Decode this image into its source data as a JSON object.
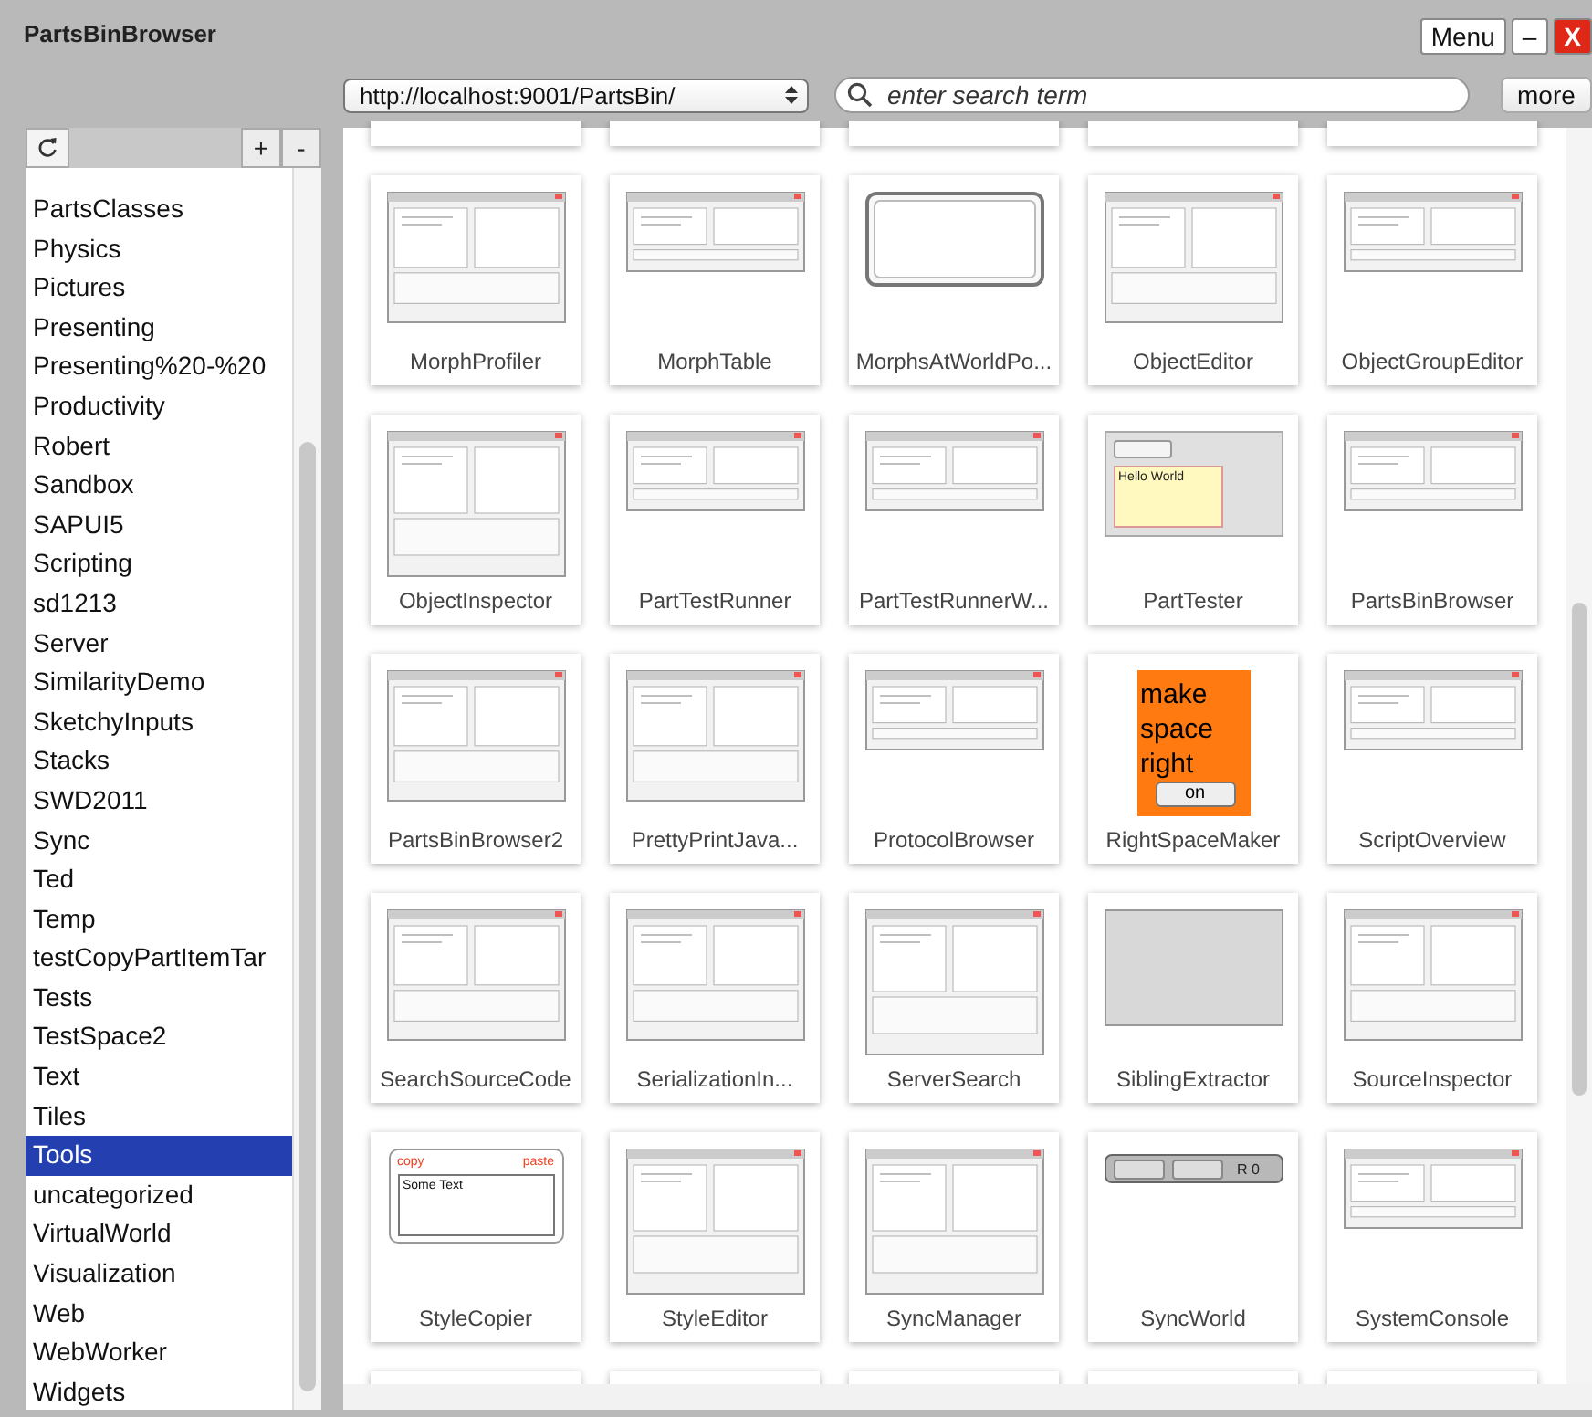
{
  "window": {
    "title": "PartsBinBrowser",
    "buttons": [
      {
        "label": "Menu",
        "kind": "text"
      },
      {
        "label": "–",
        "kind": "text"
      },
      {
        "label": "X",
        "kind": "close"
      }
    ]
  },
  "toolbar": {
    "url": "http://localhost:9001/PartsBin/",
    "search": {
      "placeholder": "enter search term"
    },
    "more_button": "more"
  },
  "categories": {
    "add_button": "+",
    "remove_button": "-",
    "items": [
      {
        "label": "PartsClasses",
        "selected": false
      },
      {
        "label": "Physics",
        "selected": false
      },
      {
        "label": "Pictures",
        "selected": false
      },
      {
        "label": "Presenting",
        "selected": false
      },
      {
        "label": "Presenting%20-%20",
        "selected": false
      },
      {
        "label": "Productivity",
        "selected": false
      },
      {
        "label": "Robert",
        "selected": false
      },
      {
        "label": "Sandbox",
        "selected": false
      },
      {
        "label": "SAPUI5",
        "selected": false
      },
      {
        "label": "Scripting",
        "selected": false
      },
      {
        "label": "sd1213",
        "selected": false
      },
      {
        "label": "Server",
        "selected": false
      },
      {
        "label": "SimilarityDemo",
        "selected": false
      },
      {
        "label": "SketchyInputs",
        "selected": false
      },
      {
        "label": "Stacks",
        "selected": false
      },
      {
        "label": "SWD2011",
        "selected": false
      },
      {
        "label": "Sync",
        "selected": false
      },
      {
        "label": "Ted",
        "selected": false
      },
      {
        "label": "Temp",
        "selected": false
      },
      {
        "label": "testCopyPartItemTar",
        "selected": false
      },
      {
        "label": "Tests",
        "selected": false
      },
      {
        "label": "TestSpace2",
        "selected": false
      },
      {
        "label": "Text",
        "selected": false
      },
      {
        "label": "Tiles",
        "selected": false
      },
      {
        "label": "Tools",
        "selected": true
      },
      {
        "label": "uncategorized",
        "selected": false
      },
      {
        "label": "VirtualWorld",
        "selected": false
      },
      {
        "label": "Visualization",
        "selected": false
      },
      {
        "label": "Web",
        "selected": false
      },
      {
        "label": "WebWorker",
        "selected": false
      },
      {
        "label": "Widgets",
        "selected": false
      }
    ]
  },
  "parts": [
    {
      "name": "MorphProfiler",
      "thumb": {
        "kind": "window"
      }
    },
    {
      "name": "MorphTable",
      "thumb": {
        "kind": "strip"
      }
    },
    {
      "name": "MorphsAtWorldPo...",
      "thumb": {
        "kind": "frame"
      }
    },
    {
      "name": "ObjectEditor",
      "thumb": {
        "kind": "window"
      }
    },
    {
      "name": "ObjectGroupEditor",
      "thumb": {
        "kind": "strip"
      }
    },
    {
      "name": "ObjectInspector",
      "thumb": {
        "kind": "column"
      }
    },
    {
      "name": "PartTestRunner",
      "thumb": {
        "kind": "strip"
      }
    },
    {
      "name": "PartTestRunnerW...",
      "thumb": {
        "kind": "strip"
      }
    },
    {
      "name": "PartTester",
      "thumb": {
        "kind": "note",
        "texts": [
          "Hello World"
        ]
      }
    },
    {
      "name": "PartsBinBrowser",
      "thumb": {
        "kind": "strip"
      }
    },
    {
      "name": "PartsBinBrowser2",
      "thumb": {
        "kind": "window"
      }
    },
    {
      "name": "PrettyPrintJava...",
      "thumb": {
        "kind": "window"
      }
    },
    {
      "name": "ProtocolBrowser",
      "thumb": {
        "kind": "strip"
      }
    },
    {
      "name": "RightSpaceMaker",
      "thumb": {
        "kind": "orange",
        "texts": [
          "make space right",
          "on"
        ]
      }
    },
    {
      "name": "ScriptOverview",
      "thumb": {
        "kind": "strip"
      }
    },
    {
      "name": "SearchSourceCode",
      "thumb": {
        "kind": "window"
      }
    },
    {
      "name": "SerializationIn...",
      "thumb": {
        "kind": "window"
      }
    },
    {
      "name": "ServerSearch",
      "thumb": {
        "kind": "column"
      }
    },
    {
      "name": "SiblingExtractor",
      "thumb": {
        "kind": "gray"
      }
    },
    {
      "name": "SourceInspector",
      "thumb": {
        "kind": "window"
      }
    },
    {
      "name": "StyleCopier",
      "thumb": {
        "kind": "copier",
        "texts": [
          "copy",
          "paste",
          "Some Text"
        ]
      }
    },
    {
      "name": "StyleEditor",
      "thumb": {
        "kind": "column"
      }
    },
    {
      "name": "SyncManager",
      "thumb": {
        "kind": "column"
      }
    },
    {
      "name": "SyncWorld",
      "thumb": {
        "kind": "toolbar",
        "texts": [
          "R 0"
        ]
      }
    },
    {
      "name": "SystemConsole",
      "thumb": {
        "kind": "strip"
      }
    }
  ]
}
